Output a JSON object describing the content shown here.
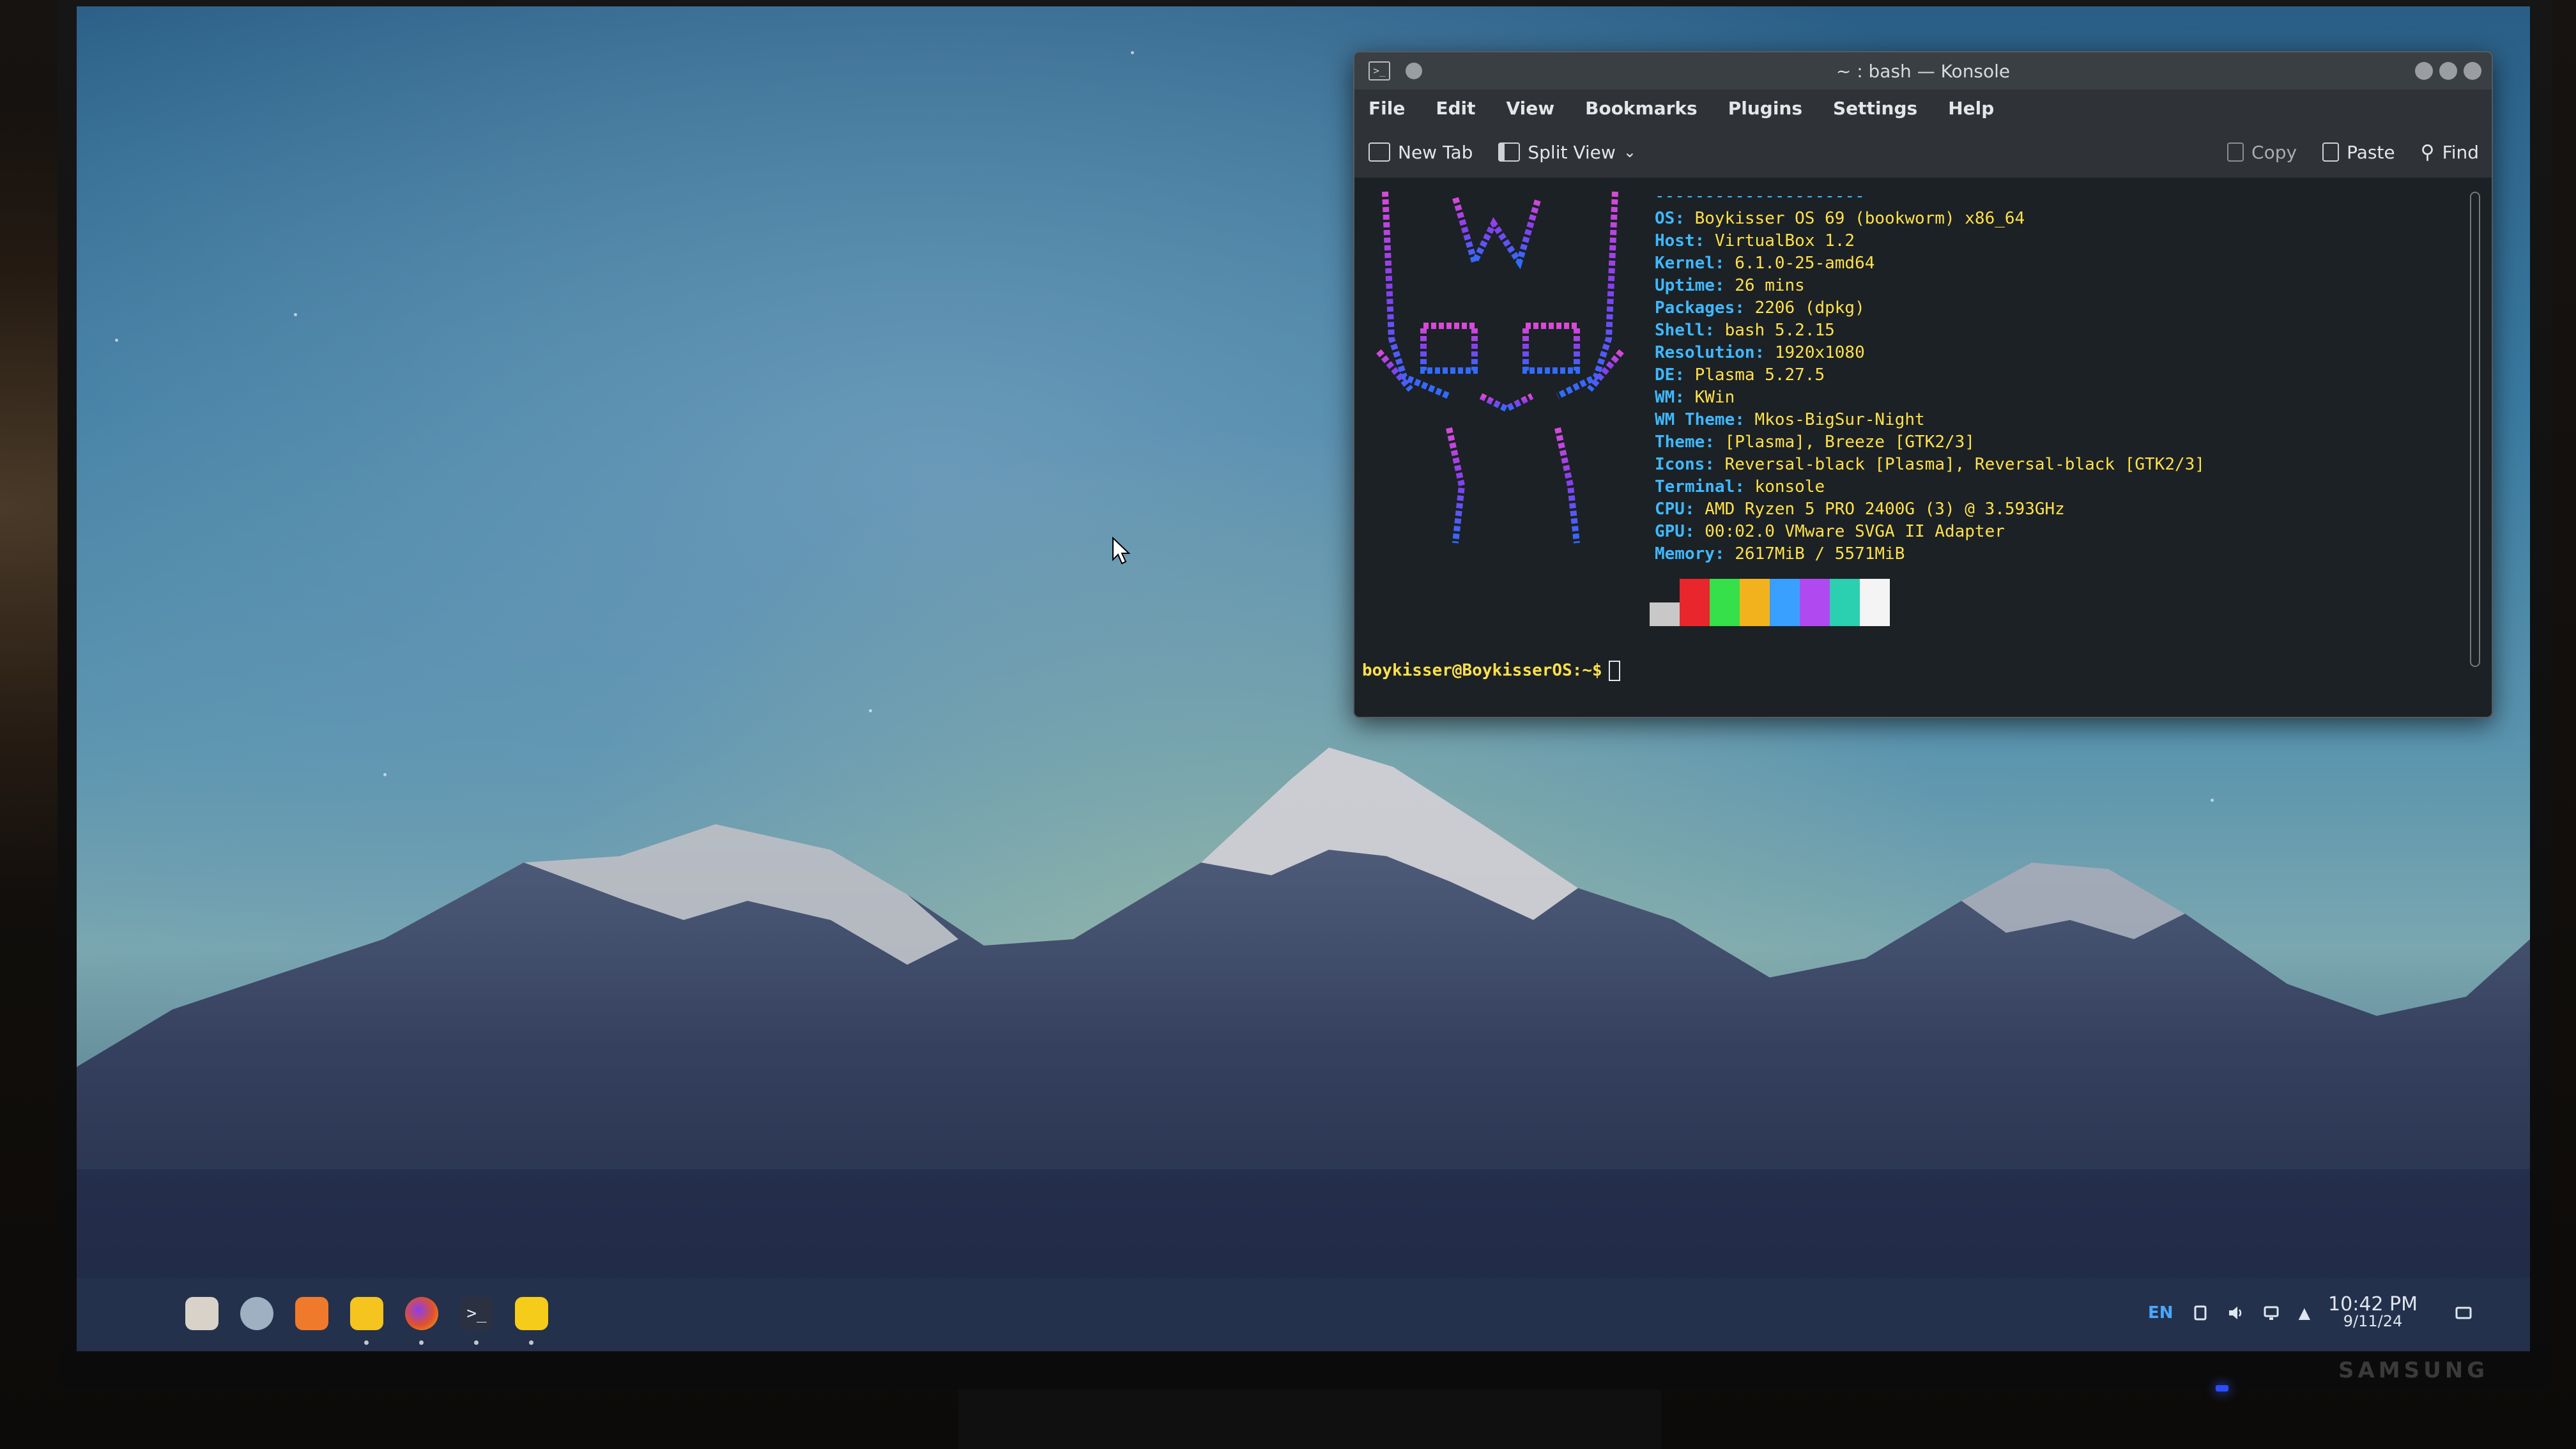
{
  "konsole": {
    "title": "~ : bash — Konsole",
    "menu": [
      "File",
      "Edit",
      "View",
      "Bookmarks",
      "Plugins",
      "Settings",
      "Help"
    ],
    "toolbar": {
      "new_tab": "New Tab",
      "split_view": "Split View",
      "copy": "Copy",
      "paste": "Paste",
      "find": "Find"
    },
    "neofetch": {
      "separator": "---------------------",
      "lines": [
        {
          "key": "OS",
          "value": "Boykisser OS 69 (bookworm) x86_64"
        },
        {
          "key": "Host",
          "value": "VirtualBox 1.2"
        },
        {
          "key": "Kernel",
          "value": "6.1.0-25-amd64"
        },
        {
          "key": "Uptime",
          "value": "26 mins"
        },
        {
          "key": "Packages",
          "value": "2206 (dpkg)"
        },
        {
          "key": "Shell",
          "value": "bash 5.2.15"
        },
        {
          "key": "Resolution",
          "value": "1920x1080"
        },
        {
          "key": "DE",
          "value": "Plasma 5.27.5"
        },
        {
          "key": "WM",
          "value": "KWin"
        },
        {
          "key": "WM Theme",
          "value": "Mkos-BigSur-Night"
        },
        {
          "key": "Theme",
          "value": "[Plasma], Breeze [GTK2/3]"
        },
        {
          "key": "Icons",
          "value": "Reversal-black [Plasma], Reversal-black [GTK2/3]"
        },
        {
          "key": "Terminal",
          "value": "konsole"
        },
        {
          "key": "CPU",
          "value": "AMD Ryzen 5 PRO 2400G (3) @ 3.593GHz"
        },
        {
          "key": "GPU",
          "value": "00:02.0 VMware SVGA II Adapter"
        },
        {
          "key": "Memory",
          "value": "2617MiB / 5571MiB"
        }
      ],
      "palette": [
        "#c8c8c8",
        "#e8262c",
        "#35e04a",
        "#f2b21e",
        "#3aa0ff",
        "#b04af0",
        "#2ad0b0",
        "#f4f4f4"
      ]
    },
    "prompt": "boykisser@BoykisserOS:~$"
  },
  "taskbar": {
    "dock": [
      {
        "name": "boykisser-logo-icon",
        "color": "#d8d2c8"
      },
      {
        "name": "system-settings-icon",
        "color": "#9fb0c2"
      },
      {
        "name": "discover-store-icon",
        "color": "#f07a2c"
      },
      {
        "name": "files-icon",
        "color": "#f5c41e"
      },
      {
        "name": "firefox-icon",
        "color": "#e0522a"
      },
      {
        "name": "terminal-icon",
        "color": "#2b3140"
      },
      {
        "name": "notes-icon",
        "color": "#f6cc1a"
      }
    ],
    "tray": {
      "lang": "EN",
      "time": "10:42 PM",
      "date": "9/11/24"
    }
  },
  "monitor": {
    "brand": "SAMSUNG"
  }
}
